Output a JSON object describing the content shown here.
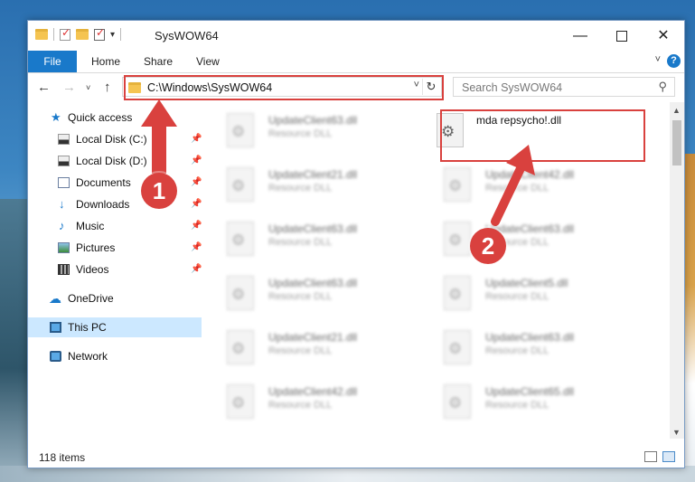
{
  "window": {
    "title": "SysWOW64"
  },
  "ribbon": {
    "file": "File",
    "home": "Home",
    "share": "Share",
    "view": "View",
    "help": "?"
  },
  "address": {
    "path": "C:\\Windows\\SysWOW64",
    "search_placeholder": "Search SysWOW64"
  },
  "sidebar": {
    "items": [
      {
        "label": "Quick access"
      },
      {
        "label": "Local Disk (C:)"
      },
      {
        "label": "Local Disk (D:)"
      },
      {
        "label": "Documents"
      },
      {
        "label": "Downloads"
      },
      {
        "label": "Music"
      },
      {
        "label": "Pictures"
      },
      {
        "label": "Videos"
      },
      {
        "label": "OneDrive"
      },
      {
        "label": "This PC"
      },
      {
        "label": "Network"
      }
    ]
  },
  "files": {
    "type_label": "Resource DLL",
    "left": [
      "UpdateClient63.dll",
      "UpdateClient21.dll",
      "UpdateClient63.dll",
      "UpdateClient63.dll",
      "UpdateClient21.dll",
      "UpdateClient42.dll"
    ],
    "right": [
      "mda repsycho!.dll",
      "UpdateClient42.dll",
      "UpdateClient63.dll",
      "UpdateClient5.dll",
      "UpdateClient63.dll",
      "UpdateClient65.dll"
    ]
  },
  "status": {
    "items": "118 items"
  },
  "annotations": {
    "step1": "1",
    "step2": "2"
  },
  "colors": {
    "accent": "#1979ca",
    "highlight": "#d9413e",
    "selected": "#cce8ff"
  }
}
